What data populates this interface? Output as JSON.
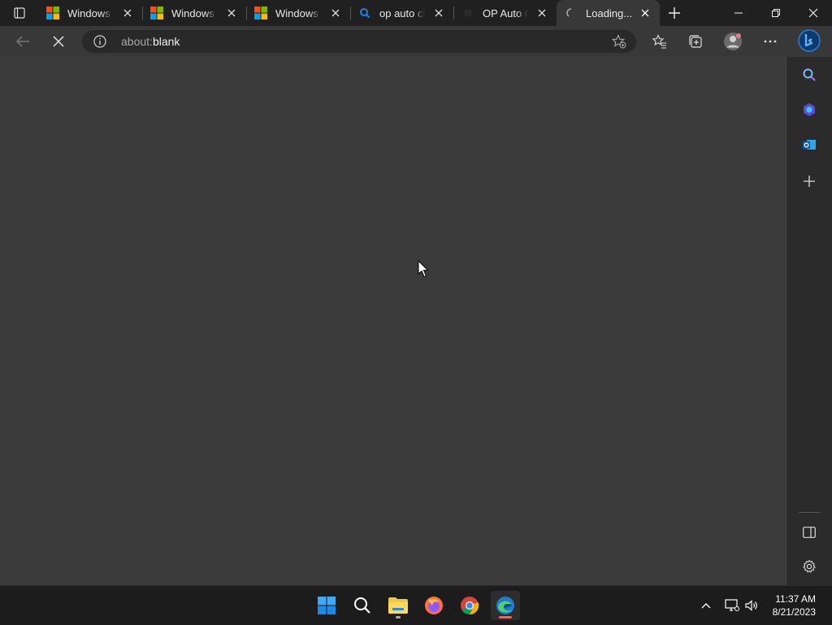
{
  "browser": {
    "tabs": [
      {
        "title": "Windows he",
        "favicon": "microsoft-logo-icon",
        "active": false
      },
      {
        "title": "Windows he",
        "favicon": "microsoft-logo-icon",
        "active": false
      },
      {
        "title": "Windows he",
        "favicon": "microsoft-logo-icon",
        "active": false
      },
      {
        "title": "op auto clic",
        "favicon": "search-icon",
        "active": false
      },
      {
        "title": "OP Auto Cli",
        "favicon": "app-icon",
        "active": false
      },
      {
        "title": "Loading...",
        "favicon": "loading-spinner-icon",
        "active": true
      }
    ],
    "address_bar": {
      "scheme": "about:",
      "host": "blank"
    }
  },
  "sidebar": {
    "items": [
      "search-icon",
      "copilot-icon",
      "outlook-icon",
      "add-icon"
    ],
    "bottom": [
      "split-screen-icon",
      "settings-icon"
    ]
  },
  "taskbar": {
    "apps": [
      "start-icon",
      "search-icon",
      "file-explorer-icon",
      "firefox-icon",
      "chrome-icon",
      "edge-icon"
    ],
    "clock": {
      "time": "11:37 AM",
      "date": "8/21/2023"
    }
  },
  "colors": {
    "accent": "#0078d4",
    "content_bg": "#3b3b3b",
    "toolbar_bg": "#383838",
    "taskbar_bg": "#1c1c1c"
  }
}
